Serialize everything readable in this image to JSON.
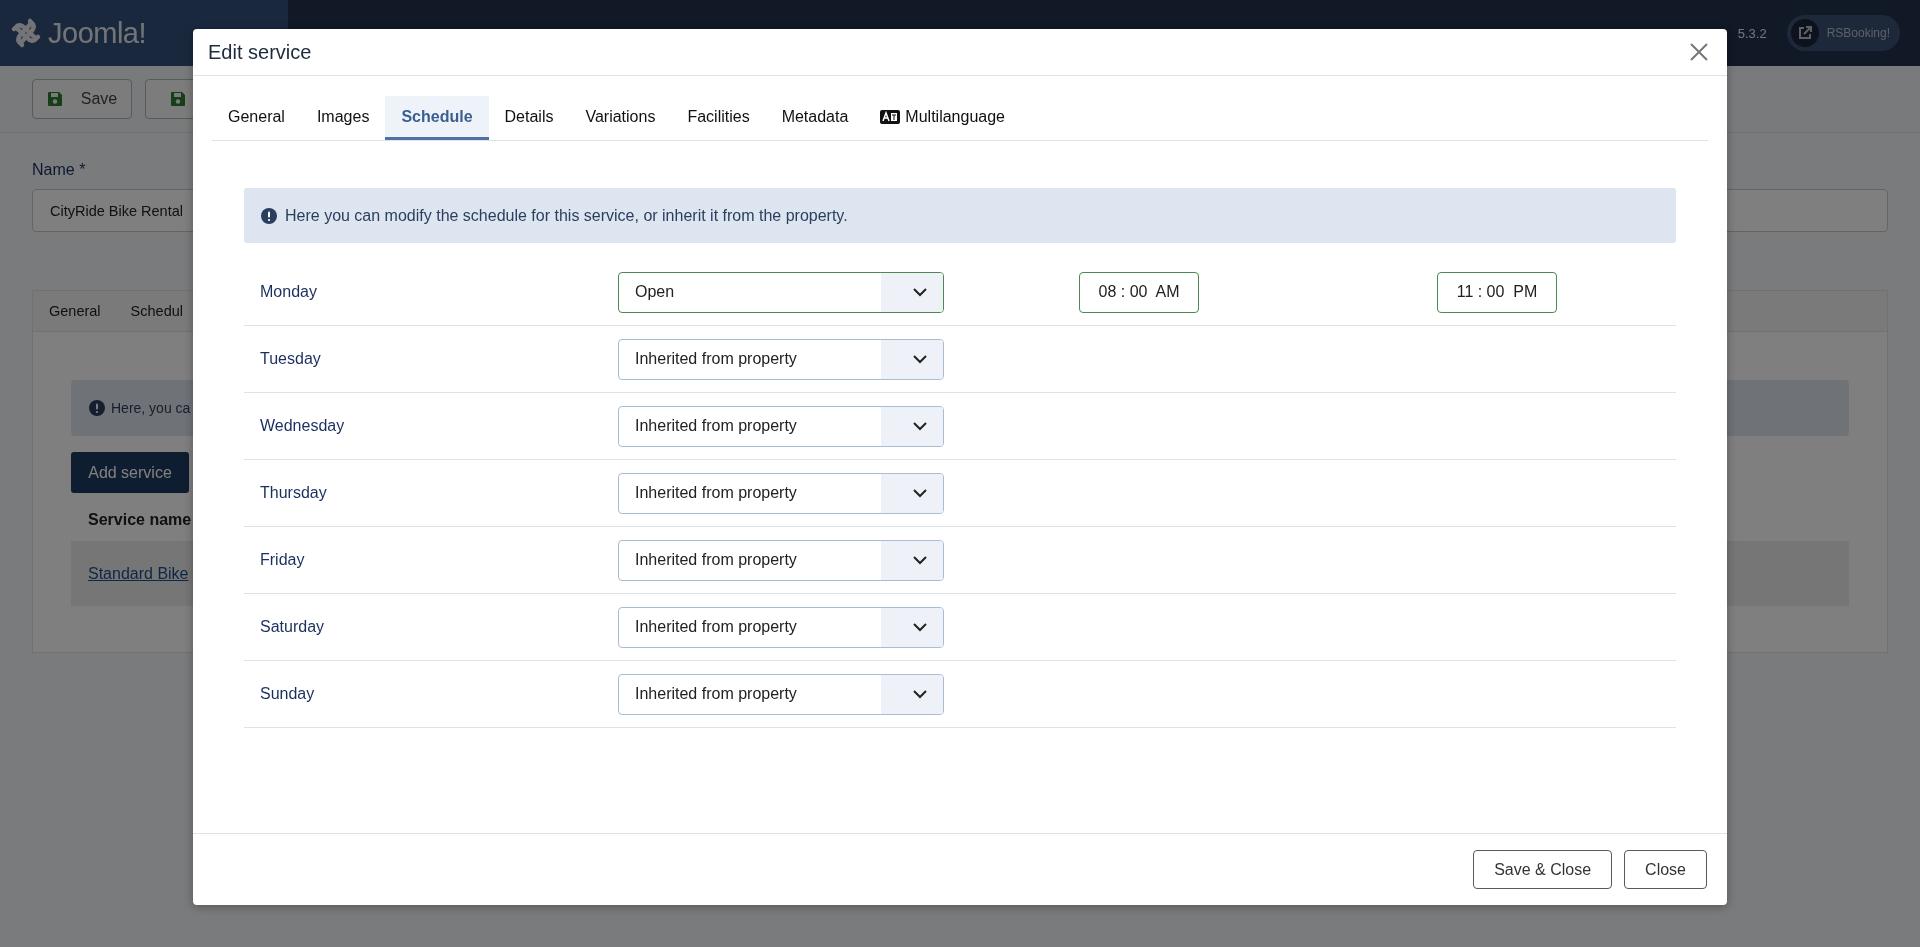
{
  "background": {
    "logo": "Joomla!",
    "version": "5.3.2",
    "site_link": "RSBooking!",
    "toolbar_buttons": [
      {
        "kind": "labeled",
        "label": "Save"
      },
      {
        "kind": "icon"
      }
    ],
    "name_field": {
      "label": "Name *",
      "value": "CityRide Bike Rental"
    },
    "tabs": [
      "General",
      "Schedul"
    ],
    "info": "Here, you ca",
    "add_button": "Add service",
    "column_header": "Service name",
    "row_link": "Standard Bike"
  },
  "modal": {
    "title": "Edit service",
    "tabs": [
      {
        "label": "General",
        "selected": false,
        "kind": "plain"
      },
      {
        "label": "Images",
        "selected": false,
        "kind": "plain"
      },
      {
        "label": "Schedule",
        "selected": true,
        "kind": "plain"
      },
      {
        "label": "Details",
        "selected": false,
        "kind": "plain"
      },
      {
        "label": "Variations",
        "selected": false,
        "kind": "plain"
      },
      {
        "label": "Facilities",
        "selected": false,
        "kind": "plain"
      },
      {
        "label": "Metadata",
        "selected": false,
        "kind": "plain"
      },
      {
        "label": "Multilanguage",
        "selected": false,
        "kind": "icon"
      }
    ],
    "info": "Here you can modify the schedule for this service, or inherit it from the property.",
    "rows": [
      {
        "day": "Monday",
        "kind": "open",
        "status": "Open",
        "opening": "08 : 00  AM",
        "closing": "11 : 00  PM"
      },
      {
        "day": "Tuesday",
        "kind": "inherited",
        "status": "Inherited from property"
      },
      {
        "day": "Wednesday",
        "kind": "inherited",
        "status": "Inherited from property"
      },
      {
        "day": "Thursday",
        "kind": "inherited",
        "status": "Inherited from property"
      },
      {
        "day": "Friday",
        "kind": "inherited",
        "status": "Inherited from property"
      },
      {
        "day": "Saturday",
        "kind": "inherited",
        "status": "Inherited from property"
      },
      {
        "day": "Sunday",
        "kind": "inherited",
        "status": "Inherited from property"
      }
    ],
    "buttons": [
      "Save & Close",
      "Close"
    ]
  }
}
